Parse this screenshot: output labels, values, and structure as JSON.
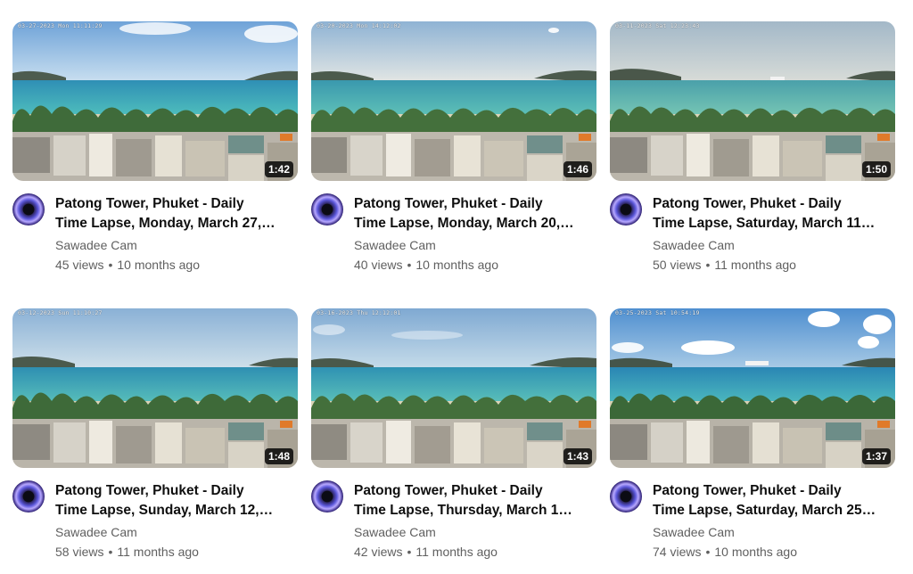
{
  "videos": [
    {
      "stamp": "03-27-2023 Mon 11:11:29",
      "duration": "1:42",
      "title_line1": "Patong Tower, Phuket - Daily",
      "title_line2": "Time Lapse, Monday, March 27,…",
      "channel": "Sawadee Cam",
      "views": "45 views",
      "age": "10 months ago"
    },
    {
      "stamp": "03-20-2023 Mon 14:12:02",
      "duration": "1:46",
      "title_line1": "Patong Tower, Phuket - Daily",
      "title_line2": "Time Lapse, Monday, March 20,…",
      "channel": "Sawadee Cam",
      "views": "40 views",
      "age": "10 months ago"
    },
    {
      "stamp": "03-11-2023 Sat 12:23:43",
      "duration": "1:50",
      "title_line1": "Patong Tower, Phuket - Daily",
      "title_line2": "Time Lapse, Saturday, March 11…",
      "channel": "Sawadee Cam",
      "views": "50 views",
      "age": "11 months ago"
    },
    {
      "stamp": "03-12-2023 Sun 11:10:27",
      "duration": "1:48",
      "title_line1": "Patong Tower, Phuket - Daily",
      "title_line2": "Time Lapse, Sunday, March 12,…",
      "channel": "Sawadee Cam",
      "views": "58 views",
      "age": "11 months ago"
    },
    {
      "stamp": "03-16-2023 Thu 12:12:01",
      "duration": "1:43",
      "title_line1": "Patong Tower, Phuket - Daily",
      "title_line2": "Time Lapse, Thursday, March 1…",
      "channel": "Sawadee Cam",
      "views": "42 views",
      "age": "11 months ago"
    },
    {
      "stamp": "03-25-2023 Sat 10:54:19",
      "duration": "1:37",
      "title_line1": "Patong Tower, Phuket - Daily",
      "title_line2": "Time Lapse, Saturday, March 25…",
      "channel": "Sawadee Cam",
      "views": "74 views",
      "age": "10 months ago"
    }
  ],
  "separator": "•",
  "colors": {
    "title": "#0f0f0f",
    "meta": "#606060",
    "duration_bg": "#000000",
    "sea": "#3ea3a8",
    "sky": "#a9c9e6"
  }
}
